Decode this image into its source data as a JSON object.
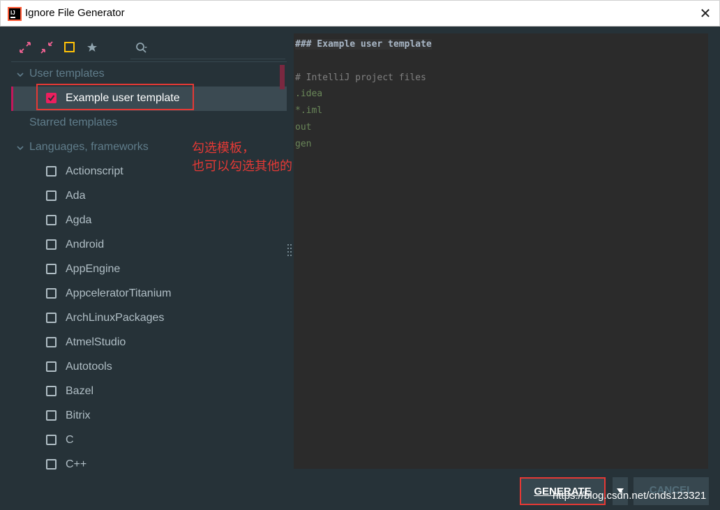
{
  "window": {
    "title": "Ignore File Generator",
    "close_glyph": "✕"
  },
  "toolbar": {
    "icons": [
      "expand-all-icon",
      "collapse-all-icon",
      "square-outline-icon",
      "star-icon"
    ],
    "search_icon": "search-icon"
  },
  "tree": {
    "user_templates_group": "User templates",
    "example_template": "Example user template",
    "starred_group": "Starred templates",
    "languages_group": "Languages, frameworks",
    "languages": [
      "Actionscript",
      "Ada",
      "Agda",
      "Android",
      "AppEngine",
      "AppceleratorTitanium",
      "ArchLinuxPackages",
      "AtmelStudio",
      "Autotools",
      "Bazel",
      "Bitrix",
      "C",
      "C++"
    ]
  },
  "annotation": {
    "line1": "勾选模板，",
    "line2": "也可以勾选其他的，自行配置。"
  },
  "editor": {
    "lines": [
      "### Example user template",
      "",
      "# IntelliJ project files",
      ".idea",
      "*.iml",
      "out",
      "gen"
    ]
  },
  "buttons": {
    "generate": "GENERATE",
    "cancel": "CANCEL"
  },
  "watermark": "https://blog.csdn.net/cnds123321",
  "colors": {
    "accent": "#ec1f5e",
    "background": "#263238",
    "editor_bg": "#2b2b2b",
    "annotation": "#e53935"
  }
}
